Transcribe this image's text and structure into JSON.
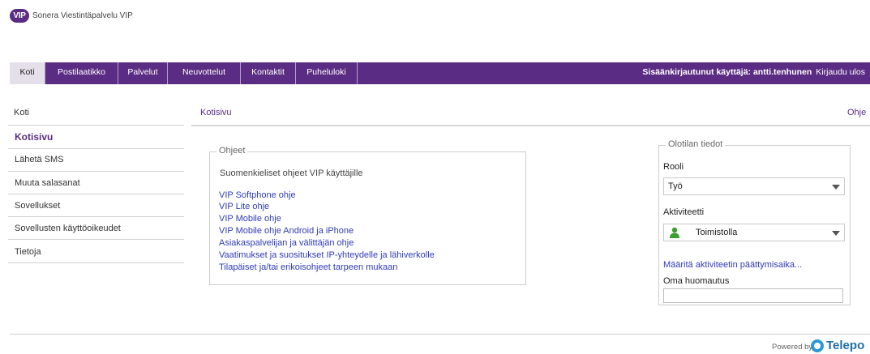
{
  "brand": {
    "logo_text": "VIP",
    "name": "Sonera Viestintäpalvelu VIP"
  },
  "nav": {
    "tabs": [
      {
        "label": "Koti",
        "active": true
      },
      {
        "label": "Postilaatikko",
        "active": false
      },
      {
        "label": "Palvelut",
        "active": false
      },
      {
        "label": "Neuvottelut",
        "active": false
      },
      {
        "label": "Kontaktit",
        "active": false
      },
      {
        "label": "Puheluloki",
        "active": false
      }
    ],
    "logged_in_label": "Sisäänkirjautunut käyttäjä: antti.tenhunen",
    "logout_label": "Kirjaudu ulos"
  },
  "sidebar": {
    "header": "Koti",
    "items": [
      {
        "label": "Kotisivu",
        "active": true
      },
      {
        "label": "Lähetä SMS",
        "active": false
      },
      {
        "label": "Muuta salasanat",
        "active": false
      },
      {
        "label": "Sovellukset",
        "active": false
      },
      {
        "label": "Sovellusten käyttöoikeudet",
        "active": false
      },
      {
        "label": "Tietoja",
        "active": false
      }
    ]
  },
  "content": {
    "breadcrumb": "Kotisivu",
    "help_link": "Ohje",
    "instructions": {
      "legend": "Ohjeet",
      "intro": "Suomenkieliset ohjeet VIP käyttäjille",
      "links": [
        "VIP Softphone ohje",
        "VIP Lite ohje",
        "VIP Mobile ohje",
        "VIP Mobile ohje Android ja iPhone",
        "Asiakaspalvelijan ja välittäjän ohje",
        "Vaatimukset ja suositukset IP-yhteydelle ja lähiverkolle",
        "Tilapäiset ja/tai erikoisohjeet tarpeen mukaan"
      ]
    },
    "presence": {
      "legend": "Olotilan tiedot",
      "role_label": "Rooli",
      "role_value": "Työ",
      "activity_label": "Aktiviteetti",
      "activity_value": "Toimistolla",
      "activity_icon": "user-green-icon",
      "activity_color": "#3aa02c",
      "deadline_link": "Määritä aktiviteetin päättymisaika...",
      "note_label": "Oma huomautus",
      "note_value": ""
    }
  },
  "footer": {
    "powered_by": "Powered by",
    "company": "Telepo"
  },
  "colors": {
    "brand_purple": "#5b2c83",
    "link_blue": "#2f3cb5"
  }
}
